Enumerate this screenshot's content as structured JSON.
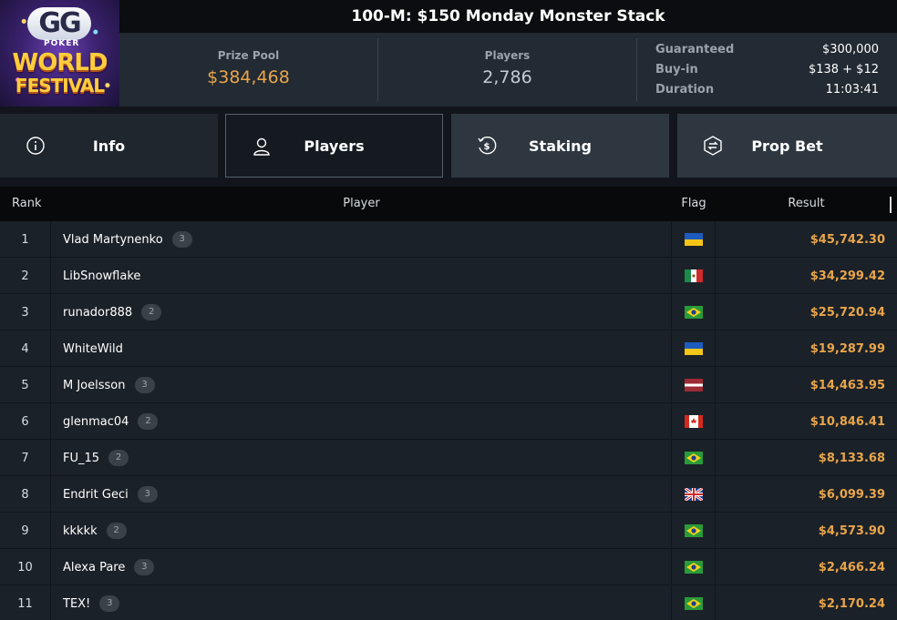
{
  "header": {
    "logo": {
      "line1": "GG",
      "line2": "POKER",
      "line3": "WORLD",
      "line4": "FESTIVAL"
    },
    "title": "100-M: $150 Monday Monster Stack",
    "prize_pool": {
      "label": "Prize Pool",
      "value": "$384,468"
    },
    "players": {
      "label": "Players",
      "value": "2,786"
    },
    "details": [
      {
        "label": "Guaranteed",
        "value": "$300,000"
      },
      {
        "label": "Buy-in",
        "value": "$138 + $12"
      },
      {
        "label": "Duration",
        "value": "11:03:41"
      }
    ]
  },
  "tabs": [
    {
      "label": "Info",
      "icon": "info-icon"
    },
    {
      "label": "Players",
      "icon": "user-icon",
      "active": true
    },
    {
      "label": "Staking",
      "icon": "dollar-icon"
    },
    {
      "label": "Prop Bet",
      "icon": "prop-bet-icon"
    }
  ],
  "table": {
    "headers": {
      "rank": "Rank",
      "player": "Player",
      "flag": "Flag",
      "result": "Result"
    },
    "rows": [
      {
        "rank": "1",
        "player": "Vlad Martynenko",
        "badge": "3",
        "flag": "ukraine",
        "result": "$45,742.30"
      },
      {
        "rank": "2",
        "player": "LibSnowflake",
        "badge": "",
        "flag": "mexico",
        "result": "$34,299.42"
      },
      {
        "rank": "3",
        "player": "runador888",
        "badge": "2",
        "flag": "brazil",
        "result": "$25,720.94"
      },
      {
        "rank": "4",
        "player": "WhiteWild",
        "badge": "",
        "flag": "ukraine",
        "result": "$19,287.99"
      },
      {
        "rank": "5",
        "player": "M Joelsson",
        "badge": "3",
        "flag": "latvia",
        "result": "$14,463.95"
      },
      {
        "rank": "6",
        "player": "glenmac04",
        "badge": "2",
        "flag": "canada",
        "result": "$10,846.41"
      },
      {
        "rank": "7",
        "player": "FU_15",
        "badge": "2",
        "flag": "brazil",
        "result": "$8,133.68"
      },
      {
        "rank": "8",
        "player": "Endrit Geci",
        "badge": "3",
        "flag": "uk",
        "result": "$6,099.39"
      },
      {
        "rank": "9",
        "player": "kkkkk",
        "badge": "2",
        "flag": "brazil",
        "result": "$4,573.90"
      },
      {
        "rank": "10",
        "player": "Alexa Pare",
        "badge": "3",
        "flag": "brazil",
        "result": "$2,466.24"
      },
      {
        "rank": "11",
        "player": "TEX!",
        "badge": "3",
        "flag": "brazil",
        "result": "$2,170.24"
      }
    ]
  },
  "colors": {
    "accent": "#e8a54b",
    "background": "#12161c",
    "row": "#1b2128",
    "header": "#222a33"
  }
}
